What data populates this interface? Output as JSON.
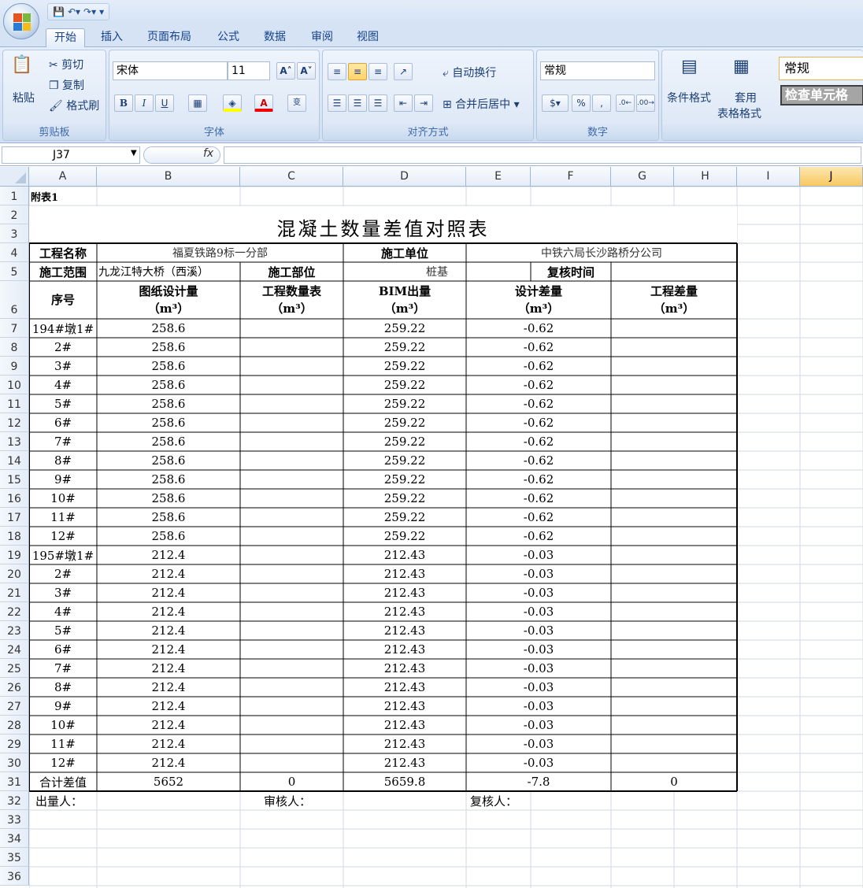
{
  "app": {
    "tabs": [
      "开始",
      "插入",
      "页面布局",
      "公式",
      "数据",
      "审阅",
      "视图"
    ],
    "active_tab": "开始"
  },
  "ribbon": {
    "clipboard": {
      "label": "剪贴板",
      "paste": "粘贴",
      "cut": "剪切",
      "copy": "复制",
      "format_painter": "格式刷"
    },
    "font": {
      "label": "字体",
      "font_name": "宋体",
      "font_size": "11"
    },
    "alignment": {
      "label": "对齐方式",
      "wrap": "自动换行",
      "merge": "合并后居中"
    },
    "number": {
      "label": "数字",
      "format": "常规"
    },
    "styles": {
      "conditional": "条件格式",
      "table_line1": "套用",
      "table_line2": "表格格式",
      "style_normal": "常规",
      "style_check": "检查单元格"
    }
  },
  "formula_bar": {
    "name_box": "J37",
    "fx": "fx",
    "content": ""
  },
  "columns": [
    "A",
    "B",
    "C",
    "D",
    "E",
    "F",
    "G",
    "H",
    "I",
    "J"
  ],
  "selected_column": "J",
  "rows": [
    "1",
    "2",
    "3",
    "4",
    "5",
    "6",
    "7",
    "8",
    "9",
    "10",
    "11",
    "12",
    "13",
    "14",
    "15",
    "16",
    "17",
    "18",
    "19",
    "20",
    "21",
    "22",
    "23",
    "24",
    "25",
    "26",
    "27",
    "28",
    "29",
    "30",
    "31",
    "32",
    "33",
    "34",
    "35",
    "36"
  ],
  "sheet": {
    "appendix": "附表1",
    "title": "混凝土数量差值对照表",
    "project_name_label": "工程名称",
    "project_name": "福夏铁路9标一分部",
    "builder_label": "施工单位",
    "builder": "中铁六局长沙路桥分公司",
    "scope_label": "施工范围",
    "scope": "九龙江特大桥（西溪）",
    "part_label": "施工部位",
    "part": "桩基",
    "review_time_label": "复核时间",
    "headers": {
      "seq": "序号",
      "design_qty": "图纸设计量",
      "eng_qty": "工程数量表",
      "bim_qty": "BIM出量",
      "design_diff": "设计差量",
      "eng_diff": "工程差量",
      "unit": "（m³）"
    },
    "data_rows": [
      {
        "seq": "194#墩1#",
        "design": "258.6",
        "eng": "",
        "bim": "259.22",
        "ddiff": "-0.62",
        "ediff": ""
      },
      {
        "seq": "2#",
        "design": "258.6",
        "eng": "",
        "bim": "259.22",
        "ddiff": "-0.62",
        "ediff": ""
      },
      {
        "seq": "3#",
        "design": "258.6",
        "eng": "",
        "bim": "259.22",
        "ddiff": "-0.62",
        "ediff": ""
      },
      {
        "seq": "4#",
        "design": "258.6",
        "eng": "",
        "bim": "259.22",
        "ddiff": "-0.62",
        "ediff": ""
      },
      {
        "seq": "5#",
        "design": "258.6",
        "eng": "",
        "bim": "259.22",
        "ddiff": "-0.62",
        "ediff": ""
      },
      {
        "seq": "6#",
        "design": "258.6",
        "eng": "",
        "bim": "259.22",
        "ddiff": "-0.62",
        "ediff": ""
      },
      {
        "seq": "7#",
        "design": "258.6",
        "eng": "",
        "bim": "259.22",
        "ddiff": "-0.62",
        "ediff": ""
      },
      {
        "seq": "8#",
        "design": "258.6",
        "eng": "",
        "bim": "259.22",
        "ddiff": "-0.62",
        "ediff": ""
      },
      {
        "seq": "9#",
        "design": "258.6",
        "eng": "",
        "bim": "259.22",
        "ddiff": "-0.62",
        "ediff": ""
      },
      {
        "seq": "10#",
        "design": "258.6",
        "eng": "",
        "bim": "259.22",
        "ddiff": "-0.62",
        "ediff": ""
      },
      {
        "seq": "11#",
        "design": "258.6",
        "eng": "",
        "bim": "259.22",
        "ddiff": "-0.62",
        "ediff": ""
      },
      {
        "seq": "12#",
        "design": "258.6",
        "eng": "",
        "bim": "259.22",
        "ddiff": "-0.62",
        "ediff": ""
      },
      {
        "seq": "195#墩1#",
        "design": "212.4",
        "eng": "",
        "bim": "212.43",
        "ddiff": "-0.03",
        "ediff": ""
      },
      {
        "seq": "2#",
        "design": "212.4",
        "eng": "",
        "bim": "212.43",
        "ddiff": "-0.03",
        "ediff": ""
      },
      {
        "seq": "3#",
        "design": "212.4",
        "eng": "",
        "bim": "212.43",
        "ddiff": "-0.03",
        "ediff": ""
      },
      {
        "seq": "4#",
        "design": "212.4",
        "eng": "",
        "bim": "212.43",
        "ddiff": "-0.03",
        "ediff": ""
      },
      {
        "seq": "5#",
        "design": "212.4",
        "eng": "",
        "bim": "212.43",
        "ddiff": "-0.03",
        "ediff": ""
      },
      {
        "seq": "6#",
        "design": "212.4",
        "eng": "",
        "bim": "212.43",
        "ddiff": "-0.03",
        "ediff": ""
      },
      {
        "seq": "7#",
        "design": "212.4",
        "eng": "",
        "bim": "212.43",
        "ddiff": "-0.03",
        "ediff": ""
      },
      {
        "seq": "8#",
        "design": "212.4",
        "eng": "",
        "bim": "212.43",
        "ddiff": "-0.03",
        "ediff": ""
      },
      {
        "seq": "9#",
        "design": "212.4",
        "eng": "",
        "bim": "212.43",
        "ddiff": "-0.03",
        "ediff": ""
      },
      {
        "seq": "10#",
        "design": "212.4",
        "eng": "",
        "bim": "212.43",
        "ddiff": "-0.03",
        "ediff": ""
      },
      {
        "seq": "11#",
        "design": "212.4",
        "eng": "",
        "bim": "212.43",
        "ddiff": "-0.03",
        "ediff": ""
      },
      {
        "seq": "12#",
        "design": "212.4",
        "eng": "",
        "bim": "212.43",
        "ddiff": "-0.03",
        "ediff": ""
      }
    ],
    "total": {
      "seq": "合计差值",
      "design": "5652",
      "eng": "0",
      "bim": "5659.8",
      "ddiff": "-7.8",
      "ediff": "0"
    },
    "sign": {
      "measurer": "出量人：",
      "reviewer": "审核人：",
      "rechecker": "复核人："
    }
  }
}
